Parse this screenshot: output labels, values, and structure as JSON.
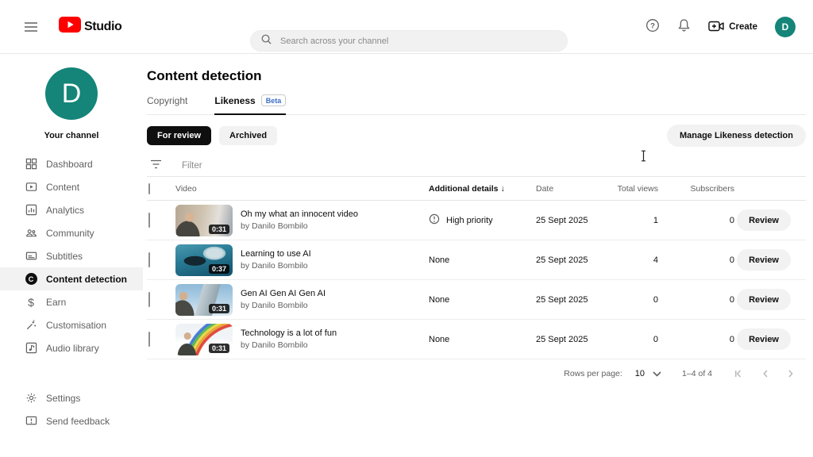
{
  "header": {
    "logo_text": "Studio",
    "search_placeholder": "Search across your channel",
    "create_label": "Create",
    "avatar_letter": "D"
  },
  "sidebar": {
    "avatar_letter": "D",
    "channel_label": "Your channel",
    "items": [
      {
        "label": "Dashboard",
        "icon": "dashboard-icon"
      },
      {
        "label": "Content",
        "icon": "content-icon"
      },
      {
        "label": "Analytics",
        "icon": "analytics-icon"
      },
      {
        "label": "Community",
        "icon": "community-icon"
      },
      {
        "label": "Subtitles",
        "icon": "subtitles-icon"
      },
      {
        "label": "Content detection",
        "icon": "content-detection-icon",
        "active": true,
        "icon_letter": "C"
      },
      {
        "label": "Earn",
        "icon": "earn-icon",
        "icon_glyph": "$"
      },
      {
        "label": "Customisation",
        "icon": "customisation-icon"
      },
      {
        "label": "Audio library",
        "icon": "audio-library-icon"
      }
    ],
    "footer_items": [
      {
        "label": "Settings",
        "icon": "settings-icon"
      },
      {
        "label": "Send feedback",
        "icon": "feedback-icon"
      }
    ]
  },
  "main": {
    "title": "Content detection",
    "tabs": [
      {
        "label": "Copyright",
        "active": false
      },
      {
        "label": "Likeness",
        "badge": "Beta",
        "active": true
      }
    ],
    "chips": [
      {
        "label": "For review",
        "selected": true
      },
      {
        "label": "Archived",
        "selected": false
      }
    ],
    "manage_button_label": "Manage Likeness detection",
    "filter_placeholder": "Filter",
    "table": {
      "headers": {
        "video": "Video",
        "details": "Additional details",
        "sort_icon": "↓",
        "date": "Date",
        "views": "Total views",
        "subscribers": "Subscribers"
      },
      "rows": [
        {
          "title": "Oh my what an innocent video",
          "author": "by Danilo Bombilo",
          "duration": "0:31",
          "thumb": "indoor-person",
          "details": "High priority",
          "details_icon": "priority-icon",
          "date": "25 Sept 2025",
          "views": "1",
          "subscribers": "0",
          "action": "Review"
        },
        {
          "title": "Learning to use AI",
          "author": "by Danilo Bombilo",
          "duration": "0:37",
          "thumb": "underwater-shark",
          "details": "None",
          "date": "25 Sept 2025",
          "views": "4",
          "subscribers": "0",
          "action": "Review"
        },
        {
          "title": "Gen AI Gen AI Gen AI",
          "author": "by Danilo Bombilo",
          "duration": "0:31",
          "thumb": "sky-building-person",
          "details": "None",
          "date": "25 Sept 2025",
          "views": "0",
          "subscribers": "0",
          "action": "Review"
        },
        {
          "title": "Technology is a lot of fun",
          "author": "by Danilo Bombilo",
          "duration": "0:31",
          "thumb": "rainbow-clouds-person",
          "details": "None",
          "date": "25 Sept 2025",
          "views": "0",
          "subscribers": "0",
          "action": "Review"
        }
      ]
    },
    "pagination": {
      "rows_per_page_label": "Rows per page:",
      "rows_per_page_value": "10",
      "range_label": "1–4 of 4"
    }
  },
  "colors": {
    "avatar_teal": "#148578",
    "brand_red": "#ff0000",
    "beta_blue": "#3b6ec5",
    "chip_black": "#0f0f0f",
    "text_secondary": "#606060"
  }
}
